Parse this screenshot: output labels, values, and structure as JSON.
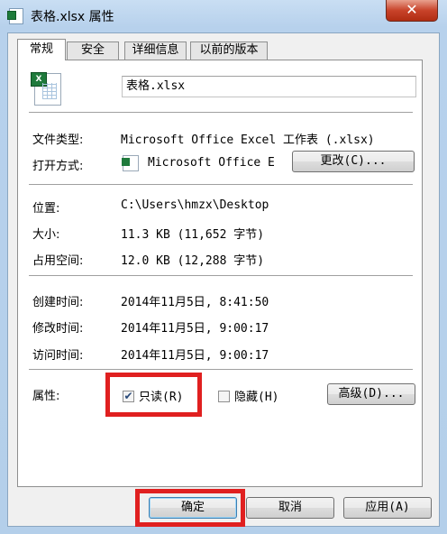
{
  "window": {
    "title": "表格.xlsx 属性",
    "close_glyph": "✕"
  },
  "tabs": [
    "常规",
    "安全",
    "详细信息",
    "以前的版本"
  ],
  "file": {
    "name": "表格.xlsx",
    "icon": "excel-file-icon"
  },
  "rows": {
    "type_label": "文件类型:",
    "type_value": "Microsoft Office Excel 工作表 (.xlsx)",
    "open_label": "打开方式:",
    "open_value": "Microsoft Office E",
    "change_button": "更改(C)...",
    "location_label": "位置:",
    "location_value": "C:\\Users\\hmzx\\Desktop",
    "size_label": "大小:",
    "size_value": "11.3 KB (11,652 字节)",
    "disk_label": "占用空间:",
    "disk_value": "12.0 KB (12,288 字节)",
    "created_label": "创建时间:",
    "created_value": "2014年11月5日, 8:41:50",
    "modified_label": "修改时间:",
    "modified_value": "2014年11月5日, 9:00:17",
    "accessed_label": "访问时间:",
    "accessed_value": "2014年11月5日, 9:00:17"
  },
  "attributes": {
    "label": "属性:",
    "readonly_label": "只读(R)",
    "readonly_checked": true,
    "readonly_checkmark": "✔",
    "hidden_label": "隐藏(H)",
    "hidden_checked": false,
    "advanced_button": "高级(D)..."
  },
  "footer": {
    "ok": "确定",
    "cancel": "取消",
    "apply": "应用(A)"
  },
  "colors": {
    "highlight": "#e02020"
  }
}
